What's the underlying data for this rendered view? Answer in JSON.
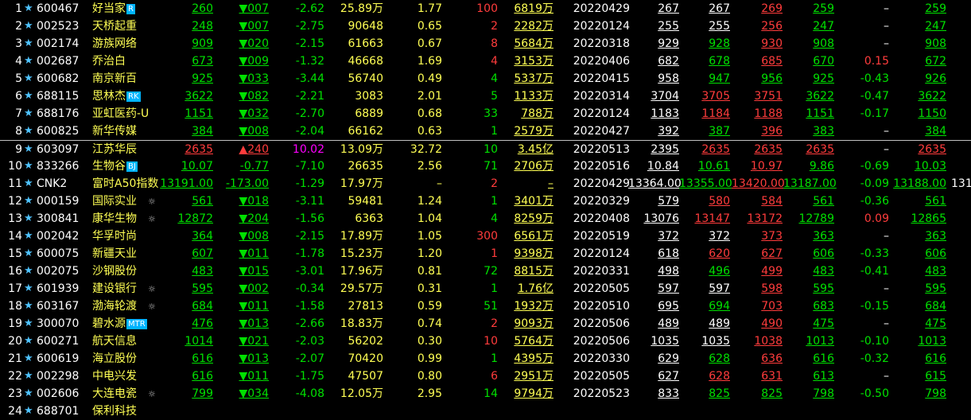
{
  "colors": {
    "up": "#ff3c3c",
    "down": "#00e000",
    "flat": "#ffffff",
    "limit_up": "#ff00ff",
    "name": "#ffff54",
    "badge": "#00b4ff"
  },
  "icons": {
    "star": "star-icon",
    "gear": "gear-icon"
  },
  "rows": [
    {
      "idx": "1",
      "star": "★",
      "code": "600467",
      "name": "好当家",
      "badge": "R",
      "gear": "",
      "price": "260",
      "price_c": "g",
      "chg": "▼007",
      "chg_c": "g",
      "pct": "-2.62",
      "pct_c": "g",
      "vol": "25.89万",
      "ratio": "1.77",
      "cur": "100",
      "cur_c": "rd",
      "amt": "6819万",
      "date": "20220429",
      "open": "267",
      "high": "267",
      "high_c": "w",
      "low": "269",
      "low_c": "rd",
      "close": "259",
      "close_c": "g",
      "diff": "–",
      "diff_c": "w",
      "last": "259",
      "last_c": "g",
      "extra": ""
    },
    {
      "idx": "2",
      "star": "★",
      "code": "002523",
      "name": "天桥起重",
      "badge": "",
      "gear": "",
      "price": "248",
      "price_c": "g",
      "chg": "▼007",
      "chg_c": "g",
      "pct": "-2.75",
      "pct_c": "g",
      "vol": "90648",
      "ratio": "0.65",
      "cur": "2",
      "cur_c": "rd",
      "amt": "2282万",
      "date": "20220124",
      "open": "255",
      "high": "255",
      "high_c": "w",
      "low": "256",
      "low_c": "rd",
      "close": "247",
      "close_c": "g",
      "diff": "–",
      "diff_c": "w",
      "last": "247",
      "last_c": "g",
      "extra": ""
    },
    {
      "idx": "3",
      "star": "★",
      "code": "002174",
      "name": "游族网络",
      "badge": "",
      "gear": "",
      "price": "909",
      "price_c": "g",
      "chg": "▼020",
      "chg_c": "g",
      "pct": "-2.15",
      "pct_c": "g",
      "vol": "61663",
      "ratio": "0.67",
      "cur": "8",
      "cur_c": "rd",
      "amt": "5684万",
      "date": "20220318",
      "open": "929",
      "high": "928",
      "high_c": "g",
      "low": "930",
      "low_c": "rd",
      "close": "908",
      "close_c": "g",
      "diff": "–",
      "diff_c": "w",
      "last": "908",
      "last_c": "g",
      "extra": ""
    },
    {
      "idx": "4",
      "star": "★",
      "code": "002687",
      "name": "乔治白",
      "badge": "",
      "gear": "",
      "price": "673",
      "price_c": "g",
      "chg": "▼009",
      "chg_c": "g",
      "pct": "-1.32",
      "pct_c": "g",
      "vol": "46668",
      "ratio": "1.69",
      "cur": "4",
      "cur_c": "rd",
      "amt": "3153万",
      "date": "20220406",
      "open": "682",
      "high": "678",
      "high_c": "g",
      "low": "685",
      "low_c": "rd",
      "close": "670",
      "close_c": "g",
      "diff": "0.15",
      "diff_c": "rd",
      "last": "672",
      "last_c": "g",
      "extra": ""
    },
    {
      "idx": "5",
      "star": "★",
      "code": "600682",
      "name": "南京新百",
      "badge": "",
      "gear": "",
      "price": "925",
      "price_c": "g",
      "chg": "▼033",
      "chg_c": "g",
      "pct": "-3.44",
      "pct_c": "g",
      "vol": "56740",
      "ratio": "0.49",
      "cur": "4",
      "cur_c": "g",
      "amt": "5337万",
      "date": "20220415",
      "open": "958",
      "high": "947",
      "high_c": "g",
      "low": "956",
      "low_c": "g",
      "close": "925",
      "close_c": "g",
      "diff": "-0.43",
      "diff_c": "g",
      "last": "926",
      "last_c": "g",
      "extra": ""
    },
    {
      "idx": "6",
      "star": "★",
      "code": "688115",
      "name": "思林杰",
      "badge": "RK",
      "gear": "",
      "price": "3622",
      "price_c": "g",
      "chg": "▼082",
      "chg_c": "g",
      "pct": "-2.21",
      "pct_c": "g",
      "vol": "3083",
      "ratio": "2.01",
      "cur": "5",
      "cur_c": "g",
      "amt": "1133万",
      "date": "20220314",
      "open": "3704",
      "high": "3705",
      "high_c": "rd",
      "low": "3751",
      "low_c": "rd",
      "close": "3622",
      "close_c": "g",
      "diff": "-0.47",
      "diff_c": "g",
      "last": "3622",
      "last_c": "g",
      "extra": ""
    },
    {
      "idx": "7",
      "star": "★",
      "code": "688176",
      "name": "亚虹医药-U",
      "badge": "",
      "gear": "",
      "price": "1151",
      "price_c": "g",
      "chg": "▼032",
      "chg_c": "g",
      "pct": "-2.70",
      "pct_c": "g",
      "vol": "6889",
      "ratio": "0.68",
      "cur": "33",
      "cur_c": "g",
      "amt": "788万",
      "date": "20220124",
      "open": "1183",
      "high": "1184",
      "high_c": "rd",
      "low": "1188",
      "low_c": "rd",
      "close": "1151",
      "close_c": "g",
      "diff": "-0.17",
      "diff_c": "g",
      "last": "1150",
      "last_c": "g",
      "extra": ""
    },
    {
      "idx": "8",
      "star": "★",
      "code": "600825",
      "name": "新华传媒",
      "badge": "",
      "gear": "",
      "price": "384",
      "price_c": "g",
      "chg": "▼008",
      "chg_c": "g",
      "pct": "-2.04",
      "pct_c": "g",
      "vol": "66162",
      "ratio": "0.63",
      "cur": "1",
      "cur_c": "g",
      "amt": "2579万",
      "date": "20220427",
      "open": "392",
      "high": "387",
      "high_c": "g",
      "low": "396",
      "low_c": "rd",
      "close": "383",
      "close_c": "g",
      "diff": "–",
      "diff_c": "w",
      "last": "384",
      "last_c": "g",
      "extra": ""
    },
    {
      "idx": "9",
      "star": "★",
      "code": "603097",
      "name": "江苏华辰",
      "badge": "",
      "gear": "",
      "price": "2635",
      "price_c": "rd",
      "chg": "▲240",
      "chg_c": "rd",
      "pct": "10.02",
      "pct_c": "m",
      "vol": "13.09万",
      "ratio": "32.72",
      "cur": "10",
      "cur_c": "g",
      "amt": "3.45亿",
      "date": "20220513",
      "open": "2395",
      "high": "2635",
      "high_c": "rd",
      "low": "2635",
      "low_c": "rd",
      "close": "2635",
      "close_c": "rd",
      "diff": "–",
      "diff_c": "w",
      "last": "2635",
      "last_c": "rd",
      "extra": ""
    },
    {
      "idx": "10",
      "star": "★",
      "code": "833266",
      "name": "生物谷",
      "badge": "BJ",
      "gear": "",
      "price": "10.07",
      "price_c": "g",
      "chg": "-0.77",
      "chg_c": "g",
      "pct": "-7.10",
      "pct_c": "g",
      "vol": "26635",
      "ratio": "2.56",
      "cur": "71",
      "cur_c": "g",
      "amt": "2706万",
      "date": "20220516",
      "open": "10.84",
      "high": "10.61",
      "high_c": "g",
      "low": "10.97",
      "low_c": "rd",
      "close": "9.86",
      "close_c": "g",
      "diff": "-0.69",
      "diff_c": "g",
      "last": "10.03",
      "last_c": "g",
      "extra": ""
    },
    {
      "idx": "11",
      "star": "★",
      "code": "CNK2",
      "name": "富时A50指数",
      "badge": "",
      "gear": "",
      "price": "13191.00",
      "price_c": "g",
      "chg": "-173.00",
      "chg_c": "g",
      "pct": "-1.29",
      "pct_c": "g",
      "vol": "17.97万",
      "ratio": "–",
      "cur": "2",
      "cur_c": "rd",
      "amt": "–",
      "date": "20220429",
      "open": "13364.00",
      "high": "13355.00",
      "high_c": "g",
      "low": "13420.00",
      "low_c": "rd",
      "close": "13187.00",
      "close_c": "g",
      "diff": "-0.09",
      "diff_c": "g",
      "last": "13188.00",
      "last_c": "g",
      "extra": "131"
    },
    {
      "idx": "12",
      "star": "★",
      "code": "000159",
      "name": "国际实业",
      "badge": "",
      "gear": "☼",
      "price": "561",
      "price_c": "g",
      "chg": "▼018",
      "chg_c": "g",
      "pct": "-3.11",
      "pct_c": "g",
      "vol": "59481",
      "ratio": "1.24",
      "cur": "1",
      "cur_c": "g",
      "amt": "3401万",
      "date": "20220329",
      "open": "579",
      "high": "580",
      "high_c": "rd",
      "low": "584",
      "low_c": "rd",
      "close": "561",
      "close_c": "g",
      "diff": "-0.36",
      "diff_c": "g",
      "last": "561",
      "last_c": "g",
      "extra": ""
    },
    {
      "idx": "13",
      "star": "★",
      "code": "300841",
      "name": "康华生物",
      "badge": "",
      "gear": "☼",
      "price": "12872",
      "price_c": "g",
      "chg": "▼204",
      "chg_c": "g",
      "pct": "-1.56",
      "pct_c": "g",
      "vol": "6363",
      "ratio": "1.04",
      "cur": "4",
      "cur_c": "g",
      "amt": "8259万",
      "date": "20220408",
      "open": "13076",
      "high": "13147",
      "high_c": "rd",
      "low": "13172",
      "low_c": "rd",
      "close": "12789",
      "close_c": "g",
      "diff": "0.09",
      "diff_c": "rd",
      "last": "12865",
      "last_c": "g",
      "extra": ""
    },
    {
      "idx": "14",
      "star": "★",
      "code": "002042",
      "name": "华孚时尚",
      "badge": "",
      "gear": "",
      "price": "364",
      "price_c": "g",
      "chg": "▼008",
      "chg_c": "g",
      "pct": "-2.15",
      "pct_c": "g",
      "vol": "17.89万",
      "ratio": "1.05",
      "cur": "300",
      "cur_c": "rd",
      "amt": "6561万",
      "date": "20220519",
      "open": "372",
      "high": "372",
      "high_c": "w",
      "low": "373",
      "low_c": "rd",
      "close": "363",
      "close_c": "g",
      "diff": "–",
      "diff_c": "w",
      "last": "363",
      "last_c": "g",
      "extra": ""
    },
    {
      "idx": "15",
      "star": "★",
      "code": "600075",
      "name": "新疆天业",
      "badge": "",
      "gear": "",
      "price": "607",
      "price_c": "g",
      "chg": "▼011",
      "chg_c": "g",
      "pct": "-1.78",
      "pct_c": "g",
      "vol": "15.23万",
      "ratio": "1.20",
      "cur": "1",
      "cur_c": "rd",
      "amt": "9398万",
      "date": "20220124",
      "open": "618",
      "high": "620",
      "high_c": "rd",
      "low": "627",
      "low_c": "rd",
      "close": "606",
      "close_c": "g",
      "diff": "-0.33",
      "diff_c": "g",
      "last": "606",
      "last_c": "g",
      "extra": ""
    },
    {
      "idx": "16",
      "star": "★",
      "code": "002075",
      "name": "沙钢股份",
      "badge": "",
      "gear": "",
      "price": "483",
      "price_c": "g",
      "chg": "▼015",
      "chg_c": "g",
      "pct": "-3.01",
      "pct_c": "g",
      "vol": "17.96万",
      "ratio": "0.81",
      "cur": "72",
      "cur_c": "g",
      "amt": "8815万",
      "date": "20220331",
      "open": "498",
      "high": "496",
      "high_c": "g",
      "low": "499",
      "low_c": "rd",
      "close": "483",
      "close_c": "g",
      "diff": "-0.41",
      "diff_c": "g",
      "last": "483",
      "last_c": "g",
      "extra": ""
    },
    {
      "idx": "17",
      "star": "★",
      "code": "601939",
      "name": "建设银行",
      "badge": "",
      "gear": "☼",
      "price": "595",
      "price_c": "g",
      "chg": "▼002",
      "chg_c": "g",
      "pct": "-0.34",
      "pct_c": "g",
      "vol": "29.57万",
      "ratio": "0.31",
      "cur": "1",
      "cur_c": "g",
      "amt": "1.76亿",
      "date": "20220505",
      "open": "597",
      "high": "597",
      "high_c": "w",
      "low": "598",
      "low_c": "rd",
      "close": "595",
      "close_c": "g",
      "diff": "–",
      "diff_c": "w",
      "last": "595",
      "last_c": "g",
      "extra": ""
    },
    {
      "idx": "18",
      "star": "★",
      "code": "603167",
      "name": "渤海轮渡",
      "badge": "",
      "gear": "☼",
      "price": "684",
      "price_c": "g",
      "chg": "▼011",
      "chg_c": "g",
      "pct": "-1.58",
      "pct_c": "g",
      "vol": "27813",
      "ratio": "0.59",
      "cur": "51",
      "cur_c": "g",
      "amt": "1932万",
      "date": "20220510",
      "open": "695",
      "high": "694",
      "high_c": "g",
      "low": "703",
      "low_c": "rd",
      "close": "683",
      "close_c": "g",
      "diff": "-0.15",
      "diff_c": "g",
      "last": "684",
      "last_c": "g",
      "extra": ""
    },
    {
      "idx": "19",
      "star": "★",
      "code": "300070",
      "name": "碧水源",
      "badge": "MTR",
      "gear": "",
      "price": "476",
      "price_c": "g",
      "chg": "▼013",
      "chg_c": "g",
      "pct": "-2.66",
      "pct_c": "g",
      "vol": "18.83万",
      "ratio": "0.74",
      "cur": "2",
      "cur_c": "rd",
      "amt": "9093万",
      "date": "20220506",
      "open": "489",
      "high": "489",
      "high_c": "w",
      "low": "490",
      "low_c": "rd",
      "close": "475",
      "close_c": "g",
      "diff": "–",
      "diff_c": "w",
      "last": "475",
      "last_c": "g",
      "extra": ""
    },
    {
      "idx": "20",
      "star": "★",
      "code": "600271",
      "name": "航天信息",
      "badge": "",
      "gear": "",
      "price": "1014",
      "price_c": "g",
      "chg": "▼021",
      "chg_c": "g",
      "pct": "-2.03",
      "pct_c": "g",
      "vol": "56202",
      "ratio": "0.30",
      "cur": "10",
      "cur_c": "rd",
      "amt": "5764万",
      "date": "20220506",
      "open": "1035",
      "high": "1035",
      "high_c": "w",
      "low": "1038",
      "low_c": "rd",
      "close": "1013",
      "close_c": "g",
      "diff": "-0.10",
      "diff_c": "g",
      "last": "1013",
      "last_c": "g",
      "extra": ""
    },
    {
      "idx": "21",
      "star": "★",
      "code": "600619",
      "name": "海立股份",
      "badge": "",
      "gear": "",
      "price": "616",
      "price_c": "g",
      "chg": "▼013",
      "chg_c": "g",
      "pct": "-2.07",
      "pct_c": "g",
      "vol": "70420",
      "ratio": "0.99",
      "cur": "1",
      "cur_c": "g",
      "amt": "4395万",
      "date": "20220330",
      "open": "629",
      "high": "628",
      "high_c": "g",
      "low": "636",
      "low_c": "rd",
      "close": "616",
      "close_c": "g",
      "diff": "-0.32",
      "diff_c": "g",
      "last": "616",
      "last_c": "g",
      "extra": ""
    },
    {
      "idx": "22",
      "star": "★",
      "code": "002298",
      "name": "中电兴发",
      "badge": "",
      "gear": "",
      "price": "616",
      "price_c": "g",
      "chg": "▼011",
      "chg_c": "g",
      "pct": "-1.75",
      "pct_c": "g",
      "vol": "47507",
      "ratio": "0.80",
      "cur": "6",
      "cur_c": "rd",
      "amt": "2951万",
      "date": "20220505",
      "open": "627",
      "high": "628",
      "high_c": "rd",
      "low": "631",
      "low_c": "rd",
      "close": "613",
      "close_c": "g",
      "diff": "–",
      "diff_c": "w",
      "last": "615",
      "last_c": "g",
      "extra": ""
    },
    {
      "idx": "23",
      "star": "★",
      "code": "002606",
      "name": "大连电瓷",
      "badge": "",
      "gear": "☼",
      "price": "799",
      "price_c": "g",
      "chg": "▼034",
      "chg_c": "g",
      "pct": "-4.08",
      "pct_c": "g",
      "vol": "12.05万",
      "ratio": "2.95",
      "cur": "14",
      "cur_c": "g",
      "amt": "9794万",
      "date": "20220523",
      "open": "833",
      "high": "825",
      "high_c": "g",
      "low": "825",
      "low_c": "g",
      "close": "798",
      "close_c": "g",
      "diff": "-0.50",
      "diff_c": "g",
      "last": "798",
      "last_c": "g",
      "extra": ""
    },
    {
      "idx": "24",
      "star": "★",
      "code": "688701",
      "name": "保利科技",
      "badge": "",
      "gear": "",
      "price": "",
      "price_c": "g",
      "chg": "",
      "chg_c": "g",
      "pct": "",
      "pct_c": "g",
      "vol": "",
      "ratio": "",
      "cur": "",
      "cur_c": "g",
      "amt": "",
      "date": "",
      "open": "",
      "high": "",
      "high_c": "w",
      "low": "",
      "low_c": "g",
      "close": "",
      "close_c": "g",
      "diff": "",
      "diff_c": "w",
      "last": "",
      "last_c": "g",
      "extra": ""
    }
  ]
}
